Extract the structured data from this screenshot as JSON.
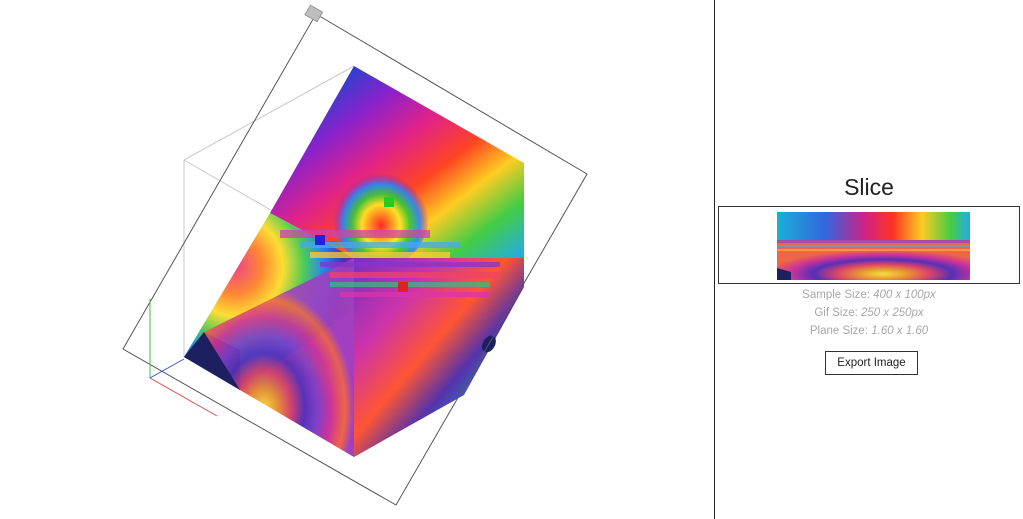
{
  "slice_panel": {
    "title": "Slice",
    "sample_size_label": "Sample Size:",
    "sample_size_value": "400 x 100px",
    "gif_size_label": "Gif Size:",
    "gif_size_value": "250 x 250px",
    "plane_size_label": "Plane Size:",
    "plane_size_value": "1.60 x 1.60",
    "export_button_label": "Export Image"
  },
  "viewport": {
    "axis_colors": {
      "x": "#e05050",
      "y": "#40c040",
      "z": "#4050d0"
    },
    "handle_colors": {
      "green": "#22cc22",
      "blue": "#2222dd",
      "red": "#dd2222"
    }
  }
}
